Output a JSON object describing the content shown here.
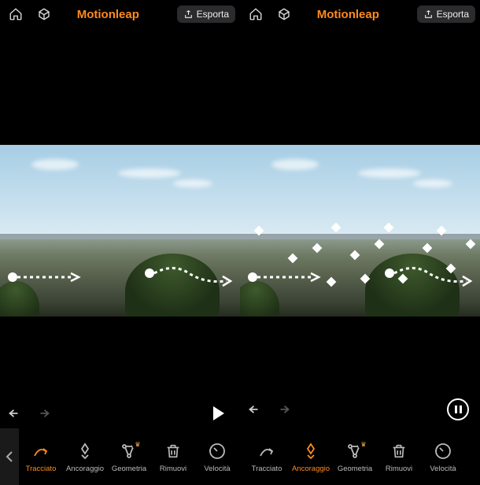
{
  "left": {
    "header": {
      "title": "Motionleap",
      "export_label": "Esporta"
    },
    "toolbar": {
      "items": [
        {
          "label": "Tracciato",
          "icon": "path-icon"
        },
        {
          "label": "Ancoraggio",
          "icon": "anchor-icon"
        },
        {
          "label": "Geometria",
          "icon": "geometry-icon"
        },
        {
          "label": "Rimuovi",
          "icon": "trash-icon"
        },
        {
          "label": "Velocità",
          "icon": "speed-icon"
        }
      ],
      "active_index": 0
    }
  },
  "right": {
    "header": {
      "title": "Motionleap",
      "export_label": "Esporta"
    },
    "toolbar": {
      "items": [
        {
          "label": "Tracciato",
          "icon": "path-icon"
        },
        {
          "label": "Ancoraggio",
          "icon": "anchor-icon"
        },
        {
          "label": "Geometria",
          "icon": "geometry-icon"
        },
        {
          "label": "Rimuovi",
          "icon": "trash-icon"
        },
        {
          "label": "Velocità",
          "icon": "speed-icon"
        }
      ],
      "active_index": 1
    }
  },
  "colors": {
    "accent": "#ff8a1f",
    "bg": "#000000"
  }
}
